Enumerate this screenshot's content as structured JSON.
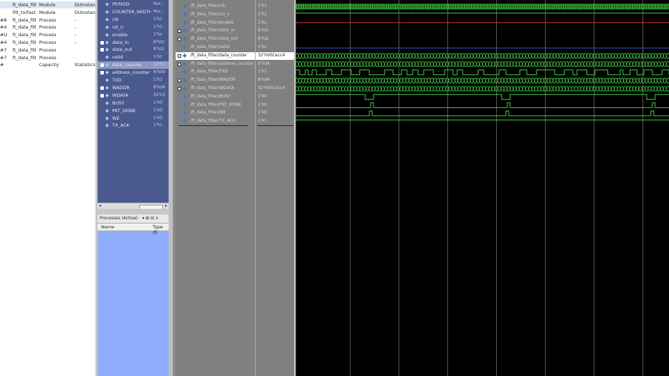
{
  "hierarchy": {
    "rows": [
      {
        "c0": "",
        "c1": "ft_data_filt",
        "c2": "Module",
        "c3": "DUInstan",
        "sel": true
      },
      {
        "c0": "",
        "c1": "filt_to(fast)",
        "c2": "Module",
        "c3": "DUInstan",
        "sel": false
      },
      {
        "c0": "#8",
        "c1": "ft_data_filt",
        "c2": "Process",
        "c3": "-",
        "sel": false
      },
      {
        "c0": "#4",
        "c1": "ft_data_filt",
        "c2": "Process",
        "c3": "-",
        "sel": false
      },
      {
        "c0": "#U",
        "c1": "ft_data_filt",
        "c2": "Process",
        "c3": "-",
        "sel": false
      },
      {
        "c0": "#4",
        "c1": "ft_data_filt",
        "c2": "Process",
        "c3": "-",
        "sel": false
      },
      {
        "c0": "#7",
        "c1": "ft_data_filt",
        "c2": "Process",
        "c3": "",
        "sel": false
      },
      {
        "c0": "#7",
        "c1": "ft_data_filt",
        "c2": "Process",
        "c3": "",
        "sel": false
      },
      {
        "c0": "#",
        "c1": "",
        "c2": "Capacity",
        "c3": "Statistics",
        "sel": false
      }
    ]
  },
  "objects": {
    "items": [
      {
        "name": "PERIOD",
        "value": "Nor...",
        "expandable": false,
        "sel": false
      },
      {
        "name": "COUNTER_WIDTH",
        "value": "Nor...",
        "expandable": false,
        "sel": false
      },
      {
        "name": "clk",
        "value": "1'h1",
        "expandable": false,
        "sel": false
      },
      {
        "name": "rst_n",
        "value": "1'h1",
        "expandable": false,
        "sel": false
      },
      {
        "name": "enable",
        "value": "1'hx",
        "expandable": false,
        "sel": false
      },
      {
        "name": "data_in",
        "value": "8'hzz",
        "expandable": true,
        "sel": false
      },
      {
        "name": "data_out",
        "value": "8'hzz",
        "expandable": true,
        "sel": false
      },
      {
        "name": "valid",
        "value": "1'hz",
        "expandable": false,
        "sel": false
      },
      {
        "name": "data_counter",
        "value": "32'h0",
        "expandable": true,
        "sel": true
      },
      {
        "name": "address_counter",
        "value": "8'hd4",
        "expandable": true,
        "sel": false
      },
      {
        "name": "TXD",
        "value": "1'h1",
        "expandable": false,
        "sel": false
      },
      {
        "name": "WADDR",
        "value": "8'hd4",
        "expandable": true,
        "sel": false
      },
      {
        "name": "WDATA",
        "value": "32'h3",
        "expandable": true,
        "sel": false
      },
      {
        "name": "BUSY",
        "value": "1'h0",
        "expandable": false,
        "sel": false
      },
      {
        "name": "PKT_DONE",
        "value": "1'h0",
        "expandable": false,
        "sel": false
      },
      {
        "name": "WE",
        "value": "1'h0",
        "expandable": false,
        "sel": false
      },
      {
        "name": "TX_ACK",
        "value": "1'h1",
        "expandable": false,
        "sel": false
      }
    ],
    "scroll_left": "◂",
    "scroll_right": "▸"
  },
  "processes": {
    "title": "Processes (Active)",
    "title_icons": "▾ ⊞ ⊟ ×",
    "col_name": "Name",
    "col_type": "Type (fi"
  },
  "waves": [
    {
      "name": "/ft_data_filter/clk",
      "value": "1'h1",
      "expandable": false,
      "sel": false
    },
    {
      "name": "/ft_data_filter/rst_n",
      "value": "1'h1",
      "expandable": false,
      "sel": false
    },
    {
      "name": "/ft_data_filter/enable",
      "value": "1'hx",
      "expandable": false,
      "sel": false
    },
    {
      "name": "/ft_data_filter/data_in",
      "value": "8'hzz",
      "expandable": true,
      "sel": false
    },
    {
      "name": "/ft_data_filter/data_out",
      "value": "8'hzz",
      "expandable": true,
      "sel": false
    },
    {
      "name": "/ft_data_filter/valid",
      "value": "1'hz",
      "expandable": false,
      "sel": false
    },
    {
      "name": "/ft_data_filter/data_counter",
      "value": "32'h00Cecc4",
      "expandable": true,
      "sel": true
    },
    {
      "name": "/ft_data_filter/address_counter",
      "value": "8'hd4",
      "expandable": true,
      "sel": false
    },
    {
      "name": "/ft_data_filter/TXD",
      "value": "1'h1",
      "expandable": false,
      "sel": false
    },
    {
      "name": "/ft_data_filter/WADDR",
      "value": "8'hd4",
      "expandable": true,
      "sel": false
    },
    {
      "name": "/ft_data_filter/WDATA",
      "value": "32'h00Cecc4",
      "expandable": true,
      "sel": false
    },
    {
      "name": "/ft_data_filter/BUSY",
      "value": "1'h0",
      "expandable": false,
      "sel": false
    },
    {
      "name": "/ft_data_filter/PKT_DONE",
      "value": "1'h0",
      "expandable": false,
      "sel": false
    },
    {
      "name": "/ft_data_filter/WE",
      "value": "1'h0",
      "expandable": false,
      "sel": false
    },
    {
      "name": "/ft_data_filter/TX_ACK",
      "value": "1'h1",
      "expandable": false,
      "sel": false
    }
  ],
  "colors": {
    "signal": "#44d044",
    "reset_line": "#e03030",
    "enable_line": "#3050e0",
    "grid": "#5a5a5a"
  }
}
